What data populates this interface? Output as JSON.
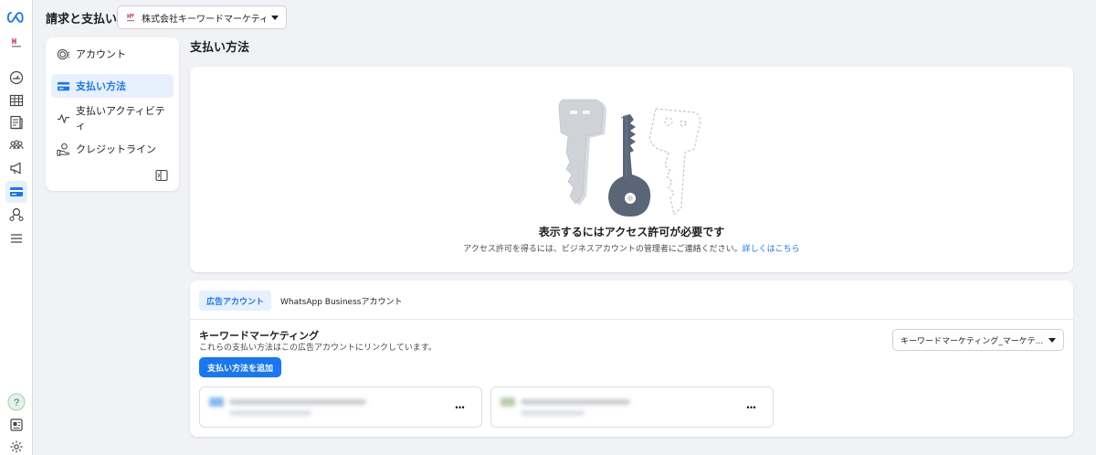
{
  "header": {
    "title": "請求と支払い",
    "business_name": "株式会社キーワードマーケティン..."
  },
  "rail": {
    "icons": [
      "meta-logo-icon",
      "business-logo-icon",
      "dashboard-icon",
      "table-icon",
      "pages-icon",
      "people-icon",
      "megaphone-icon",
      "billing-icon",
      "audience-icon",
      "menu-icon",
      "help-icon",
      "news-icon",
      "settings-icon"
    ]
  },
  "sidenav": {
    "items": [
      {
        "label": "アカウント",
        "icon": "account-icon",
        "active": false
      },
      {
        "label": "支払い方法",
        "icon": "card-icon",
        "active": true
      },
      {
        "label": "支払いアクティビティ",
        "icon": "activity-icon",
        "active": false
      },
      {
        "label": "クレジットライン",
        "icon": "credit-line-icon",
        "active": false
      }
    ]
  },
  "main": {
    "section_title": "支払い方法",
    "access": {
      "title": "表示するにはアクセス許可が必要です",
      "description": "アクセス許可を得るには、ビジネスアカウントの管理者にご連絡ください。",
      "link": "詳しくはこちら"
    },
    "tabs": [
      {
        "label": "広告アカウント",
        "active": true
      },
      {
        "label": "WhatsApp Businessアカウント",
        "active": false
      }
    ],
    "account": {
      "name": "キーワードマーケティング",
      "description": "これらの支払い方法はこの広告アカウントにリンクしています。",
      "add_button": "支払い方法を追加",
      "selector": "キーワードマーケティング_マーケテ..."
    },
    "payment_cards": [
      {
        "more": "···"
      },
      {
        "more": "···"
      }
    ]
  },
  "colors": {
    "accent": "#1877f2",
    "accent_bg": "#e7f0fd",
    "page_bg": "#f0f2f5"
  }
}
